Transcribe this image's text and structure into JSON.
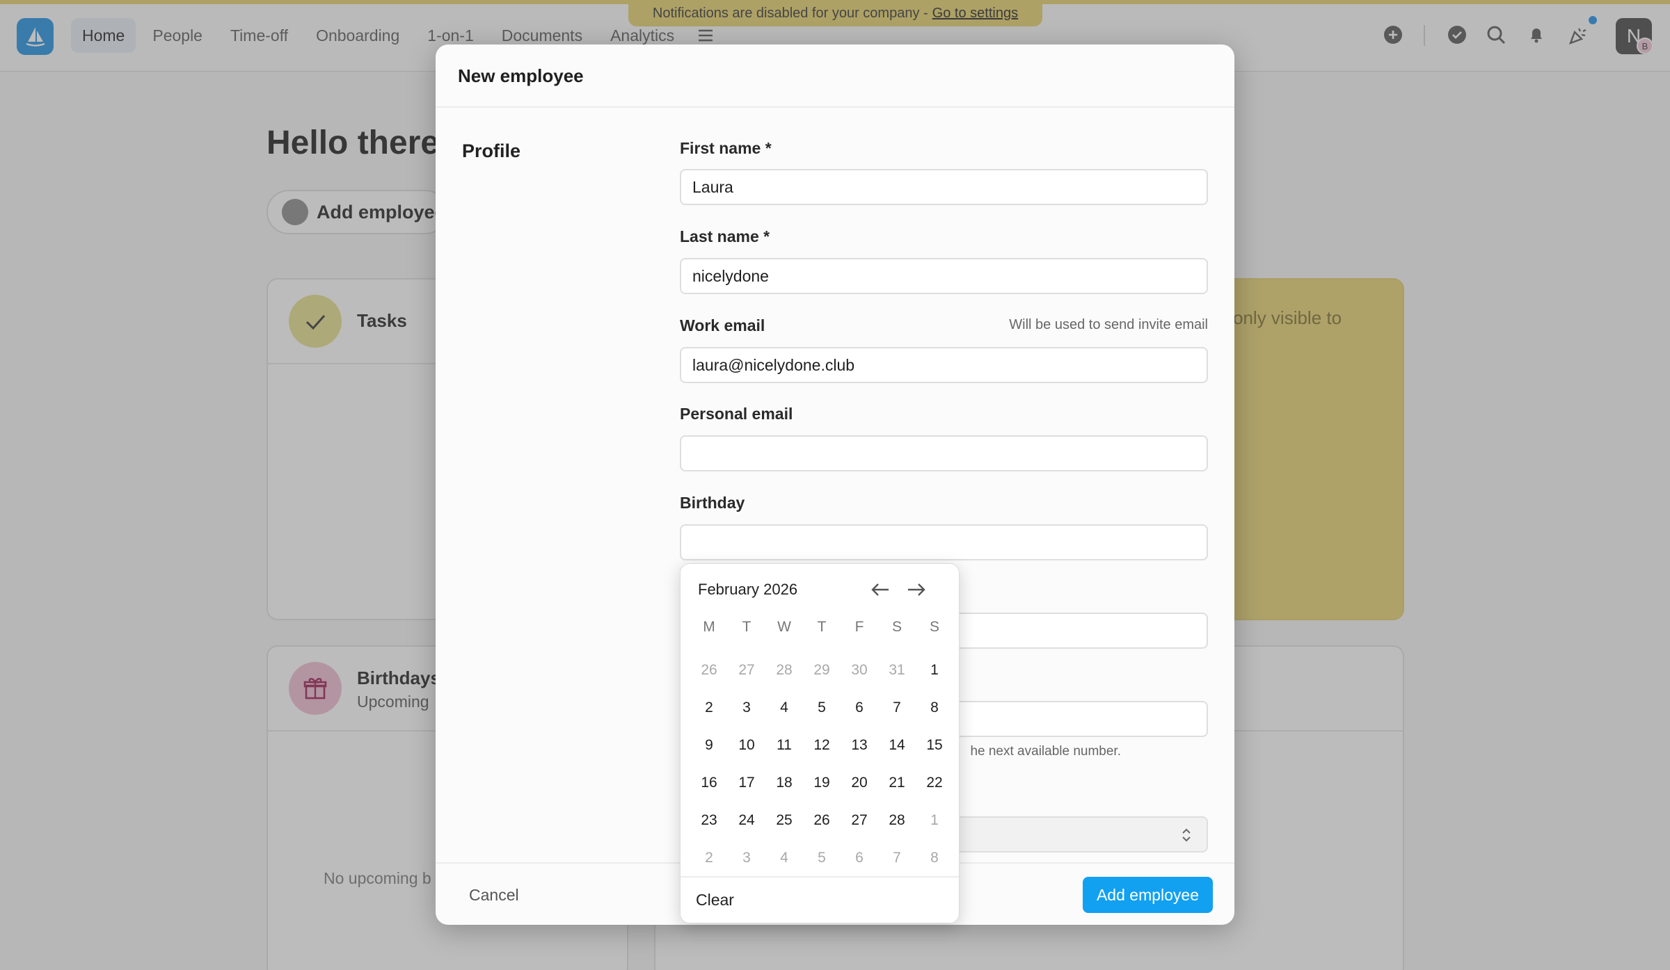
{
  "notice": {
    "text": "Notifications are disabled for your company -",
    "link": "Go to settings"
  },
  "nav": [
    {
      "label": "Home",
      "active": true
    },
    {
      "label": "People"
    },
    {
      "label": "Time-off"
    },
    {
      "label": "Onboarding"
    },
    {
      "label": "1-on-1"
    },
    {
      "label": "Documents"
    },
    {
      "label": "Analytics"
    }
  ],
  "user": {
    "initial": "N",
    "badge": "B"
  },
  "background": {
    "greeting": "Hello there,",
    "add_employee": "Add employee",
    "tasks_title": "Tasks",
    "birthdays_title": "Birthdays",
    "birthdays_sub": "Upcoming",
    "no_upcoming": "No upcoming b",
    "yellow_text": "only visible to"
  },
  "modal": {
    "title": "New employee",
    "section": "Profile",
    "fields": {
      "first_name": {
        "label": "First name *",
        "value": "Laura"
      },
      "last_name": {
        "label": "Last name *",
        "value": "nicelydone"
      },
      "work_email": {
        "label": "Work email",
        "help": "Will be used to send invite email",
        "value": "laura@nicelydone.club"
      },
      "personal_email": {
        "label": "Personal email",
        "value": ""
      },
      "birthday": {
        "label": "Birthday",
        "value": ""
      }
    },
    "employee_number_note": "he next available number.",
    "cancel": "Cancel",
    "submit": "Add employee"
  },
  "datepicker": {
    "month_label": "February 2026",
    "weekdays": [
      "M",
      "T",
      "W",
      "T",
      "F",
      "S",
      "S"
    ],
    "weeks": [
      [
        {
          "d": "26",
          "m": true
        },
        {
          "d": "27",
          "m": true
        },
        {
          "d": "28",
          "m": true
        },
        {
          "d": "29",
          "m": true
        },
        {
          "d": "30",
          "m": true
        },
        {
          "d": "31",
          "m": true
        },
        {
          "d": "1",
          "m": false
        }
      ],
      [
        {
          "d": "2",
          "m": false
        },
        {
          "d": "3",
          "m": false
        },
        {
          "d": "4",
          "m": false
        },
        {
          "d": "5",
          "m": false
        },
        {
          "d": "6",
          "m": false
        },
        {
          "d": "7",
          "m": false
        },
        {
          "d": "8",
          "m": false
        }
      ],
      [
        {
          "d": "9",
          "m": false
        },
        {
          "d": "10",
          "m": false
        },
        {
          "d": "11",
          "m": false
        },
        {
          "d": "12",
          "m": false
        },
        {
          "d": "13",
          "m": false
        },
        {
          "d": "14",
          "m": false
        },
        {
          "d": "15",
          "m": false
        }
      ],
      [
        {
          "d": "16",
          "m": false
        },
        {
          "d": "17",
          "m": false
        },
        {
          "d": "18",
          "m": false
        },
        {
          "d": "19",
          "m": false
        },
        {
          "d": "20",
          "m": false
        },
        {
          "d": "21",
          "m": false
        },
        {
          "d": "22",
          "m": false
        }
      ],
      [
        {
          "d": "23",
          "m": false
        },
        {
          "d": "24",
          "m": false
        },
        {
          "d": "25",
          "m": false
        },
        {
          "d": "26",
          "m": false
        },
        {
          "d": "27",
          "m": false
        },
        {
          "d": "28",
          "m": false
        },
        {
          "d": "1",
          "m": true
        }
      ],
      [
        {
          "d": "2",
          "m": true
        },
        {
          "d": "3",
          "m": true
        },
        {
          "d": "4",
          "m": true
        },
        {
          "d": "5",
          "m": true
        },
        {
          "d": "6",
          "m": true
        },
        {
          "d": "7",
          "m": true
        },
        {
          "d": "8",
          "m": true
        }
      ]
    ],
    "clear": "Clear"
  },
  "colors": {
    "accent": "#12a0f0",
    "brand": "#1e8fe0",
    "banner": "#e6d06a",
    "tasks_circle": "#e6df8a",
    "birthday_circle": "#f0bcd2"
  },
  "icons": [
    "app-logo-icon",
    "menu-icon",
    "plus-circle-icon",
    "check-circle-icon",
    "search-icon",
    "bell-icon",
    "party-icon",
    "checkmark-icon",
    "gift-icon",
    "arrow-left-icon",
    "arrow-right-icon",
    "chevron-updown-icon"
  ]
}
